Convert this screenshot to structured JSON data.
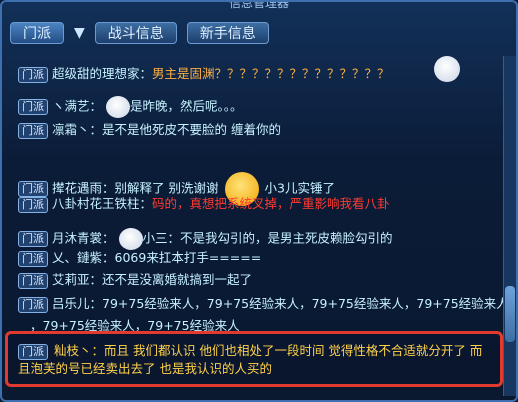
{
  "window": {
    "title": "信息管理器"
  },
  "tabs": [
    {
      "label": "门派"
    },
    {
      "label": "战斗信息"
    },
    {
      "label": "新手信息"
    }
  ],
  "channel_badge": "门派",
  "messages": [
    {
      "name": "超级甜的理想家：",
      "parts": [
        {
          "text": "男主是固渊？？？？？？？？？？？？？？",
          "color": "orange"
        }
      ]
    },
    {
      "name": "ヽ满艺：",
      "parts": [
        {
          "text": "是昨晚，然后呢。。。",
          "color": "normal"
        }
      ],
      "emote": "ghost-emote"
    },
    {
      "name": "凛霜丶：",
      "parts": [
        {
          "text": "是不是他死皮不要脸的 缠着你的",
          "color": "normal"
        }
      ]
    },
    {
      "name": "撵花遇雨：",
      "parts": [
        {
          "text": "别解释了 别洗谢谢",
          "color": "normal"
        },
        {
          "text": "小3儿实锤了",
          "color": "normal"
        }
      ],
      "emote": "smug-emote"
    },
    {
      "name": "八卦村花王铁柱：",
      "parts": [
        {
          "text": "码的，真想把系统叉掉，严重影响我看八卦",
          "color": "red"
        }
      ]
    },
    {
      "name": "月沐青裳：",
      "parts": [
        {
          "text": "小三：不是我勾引的，是男主死皮赖脸勾引的",
          "color": "normal"
        }
      ],
      "emote": "cry-emote"
    },
    {
      "name": "乂、鏈紫：",
      "parts": [
        {
          "text": "6069来扛本打手=====",
          "color": "normal"
        }
      ]
    },
    {
      "name": "艾莉亚：",
      "parts": [
        {
          "text": "还不是没离婚就搞到一起了",
          "color": "normal"
        }
      ]
    },
    {
      "name": "吕乐儿：",
      "parts": [
        {
          "text": "79+75经验来人，79+75经验来人，79+75经验来人，79+75经验来人",
          "color": "normal"
        }
      ]
    },
    {
      "name": "",
      "parts": [
        {
          "text": "，79+75经验来人，79+75经验来人",
          "color": "normal"
        }
      ]
    }
  ],
  "highlighted_message": {
    "name": "籼枝丶：",
    "text": "而且 我们都认识 他们也相处了一段时间 觉得性格不合适就分开了 而且泡芙的号已经卖出去了 也是我认识的人买的"
  },
  "colors": {
    "accent": "#3e6fae",
    "highlight_border": "#e23a2e",
    "orange": "#ffb040",
    "red": "#ff3b30",
    "text": "#c7f2ff"
  }
}
